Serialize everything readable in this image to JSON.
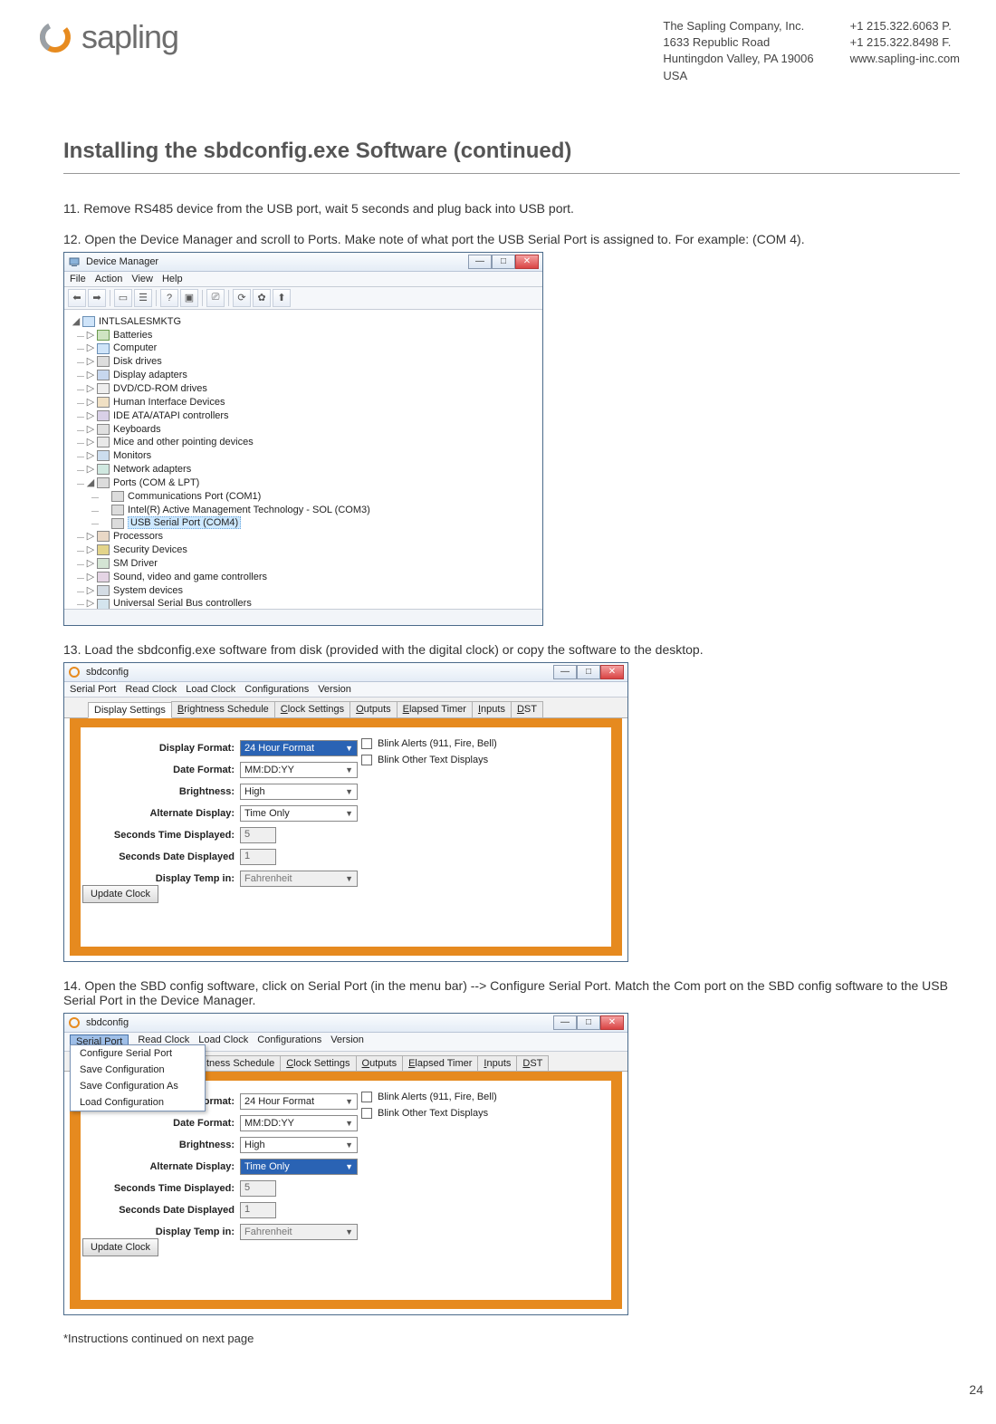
{
  "header": {
    "logo_text": "sapling",
    "company": {
      "name": "The Sapling Company, Inc.",
      "addr1": "1633 Republic Road",
      "addr2": "Huntingdon Valley, PA 19006",
      "addr3": "USA"
    },
    "contact": {
      "phone": "+1 215.322.6063 P.",
      "fax": "+1 215.322.8498 F.",
      "web": "www.sapling-inc.com"
    }
  },
  "title": "Installing the sbdconfig.exe Software (continued)",
  "steps": {
    "s11": "11. Remove RS485 device from the USB port, wait 5 seconds and plug back into USB port.",
    "s12": "12. Open the Device Manager and scroll to Ports. Make note of what port the USB Serial Port is assigned to. For example: (COM 4).",
    "s13": "13. Load the sbdconfig.exe software from disk (provided with the digital clock) or copy the software to the desktop.",
    "s14": "14. Open the SBD config software, click on Serial Port (in the menu bar) --> Configure Serial Port. Match the Com port on the SBD config software to the USB Serial Port in the Device Manager."
  },
  "device_manager": {
    "title": "Device Manager",
    "menu": [
      "File",
      "Action",
      "View",
      "Help"
    ],
    "root": "INTLSALESMKTG",
    "nodes": [
      "Batteries",
      "Computer",
      "Disk drives",
      "Display adapters",
      "DVD/CD-ROM drives",
      "Human Interface Devices",
      "IDE ATA/ATAPI controllers",
      "Keyboards",
      "Mice and other pointing devices",
      "Monitors",
      "Network adapters"
    ],
    "ports_label": "Ports (COM & LPT)",
    "ports": [
      "Communications Port (COM1)",
      "Intel(R) Active Management Technology - SOL (COM3)",
      "USB Serial Port (COM4)"
    ],
    "after": [
      "Processors",
      "Security Devices",
      "SM Driver",
      "Sound, video and game controllers",
      "System devices",
      "Universal Serial Bus controllers"
    ]
  },
  "sbd_a": {
    "title": "sbdconfig",
    "menu": [
      "Serial Port",
      "Read Clock",
      "Load Clock",
      "Configurations",
      "Version"
    ],
    "tabs": [
      "Display Settings",
      "Brightness Schedule",
      "Clock Settings",
      "Outputs",
      "Elapsed Timer",
      "Inputs",
      "DST"
    ],
    "active_tab": 0,
    "labels": {
      "display_format": "Display Format:",
      "date_format": "Date Format:",
      "brightness": "Brightness:",
      "alt_display": "Alternate Display:",
      "sec_time": "Seconds Time Displayed:",
      "sec_date": "Seconds Date Displayed",
      "temp": "Display Temp in:",
      "update": "Update Clock",
      "blink_alerts": "Blink Alerts (911, Fire, Bell)",
      "blink_other": "Blink Other Text Displays"
    },
    "values": {
      "display_format": "24 Hour Format",
      "date_format": "MM:DD:YY",
      "brightness": "High",
      "alt_display": "Time Only",
      "sec_time": "5",
      "sec_date": "1",
      "temp": "Fahrenheit"
    }
  },
  "sbd_b": {
    "title": "sbdconfig",
    "menu_open": "Serial Port",
    "menu_rest": [
      "Read Clock",
      "Load Clock",
      "Configurations",
      "Version"
    ],
    "dropdown": [
      "Configure Serial Port",
      "Save Configuration",
      "Save Configuration As",
      "Load Configuration"
    ],
    "tabs_partial_first": "tness Schedule",
    "tabs_rest": [
      "Clock Settings",
      "Outputs",
      "Elapsed Timer",
      "Inputs",
      "DST"
    ],
    "labels": {
      "format_partial": "ormat:",
      "date_format": "Date Format:",
      "brightness": "Brightness:",
      "alt_display": "Alternate Display:",
      "sec_time": "Seconds Time Displayed:",
      "sec_date": "Seconds Date Displayed",
      "temp": "Display Temp in:",
      "update": "Update Clock",
      "blink_alerts": "Blink Alerts (911, Fire, Bell)",
      "blink_other": "Blink Other Text Displays"
    },
    "values": {
      "display_format": "24 Hour Format",
      "date_format": "MM:DD:YY",
      "brightness": "High",
      "alt_display": "Time Only",
      "sec_time": "5",
      "sec_date": "1",
      "temp": "Fahrenheit"
    }
  },
  "footnote": "*Instructions continued on next page",
  "page_number": "24"
}
